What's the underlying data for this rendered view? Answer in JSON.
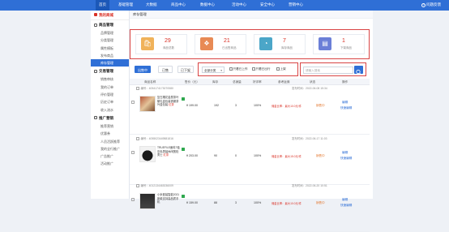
{
  "topnav": {
    "items": [
      "首页",
      "基础管理",
      "大数据",
      "商品中心",
      "数据中心",
      "活动中心",
      "安全中心",
      "营销中心"
    ],
    "help": "问题反馈"
  },
  "sidebar": {
    "shop": "我的商城",
    "groups": [
      {
        "title": "商品管理",
        "items": [
          "品牌管理",
          "分类管理",
          "属性模板",
          "发布商品",
          "库存管理"
        ]
      },
      {
        "title": "交易管理",
        "items": [
          "销售审核",
          "我的订单",
          "评价管理",
          "历史订单",
          "收入流水"
        ]
      },
      {
        "title": "推广营销",
        "items": [
          "推荐营销",
          "优惠券",
          "人员活跃推荐",
          "我的全行推广",
          "广告推广",
          "活动推广"
        ]
      }
    ],
    "active_item": "库存管理"
  },
  "breadcrumb": "库存管理",
  "stats": [
    {
      "value": "29",
      "label": "商品总数",
      "color": "#f0b25a",
      "icon": "bag-icon"
    },
    {
      "value": "21",
      "label": "已出售商品",
      "color": "#e88a55",
      "icon": "tag-icon"
    },
    {
      "value": "7",
      "label": "库存商品",
      "color": "#4ba6c8",
      "icon": "gauge-icon"
    },
    {
      "value": "1",
      "label": "下架商品",
      "color": "#6b7fd7",
      "icon": "doc-icon"
    }
  ],
  "toolbar": {
    "primary": "出售中",
    "btn2": "已售",
    "btn3": "已下架"
  },
  "filter": {
    "select": "全部分类",
    "check1": "只看已上作",
    "check2": "只看已出行",
    "check3": "上架"
  },
  "search": {
    "placeholder": "请输入搜索"
  },
  "table_headers": [
    "商品名称",
    "售价（元）",
    "库存",
    "总销量",
    "好评率",
    "参考返佣",
    "状态",
    "操作"
  ],
  "rows": [
    {
      "code": "编号：4054174173070580",
      "name": "复古雕花金属茶叶罐礼盒包装铁罐茶叶盒包装",
      "red": "红茶",
      "price": "¥ 199.00",
      "stock": "192",
      "sold": "3",
      "rate": "100%",
      "rebate": "佣金比率：最大10.0元/件",
      "status": "销售中",
      "op1": "编辑",
      "op2": "快速编辑"
    },
    {
      "code": "编号：4055023449881816",
      "name": "TRUEFILE面料T恤灰色男装休闲宽松男士",
      "red": "红茶",
      "price": "¥ 203.00",
      "stock": "90",
      "sold": "0",
      "rate": "100%",
      "rebate": "佣金比率：最大15.0元/件",
      "status": "销售中",
      "op1": "编辑",
      "op2": "快速编辑"
    },
    {
      "code": "编号：4012134463036009",
      "name": "小米套装智能2021新款支持高品质手机",
      "red": "",
      "price": "¥ 159.00",
      "stock": "88",
      "sold": "3",
      "rate": "100%",
      "rebate": "佣金比率：最大10.0元/件",
      "status": "销售中",
      "op1": "编辑",
      "op2": "快速编辑"
    }
  ],
  "row_dates": [
    "发布时间：2022-06-08 15:34",
    "发布时间：2022-06-17 11:03",
    "发布时间：2022-06-20 10:51"
  ]
}
